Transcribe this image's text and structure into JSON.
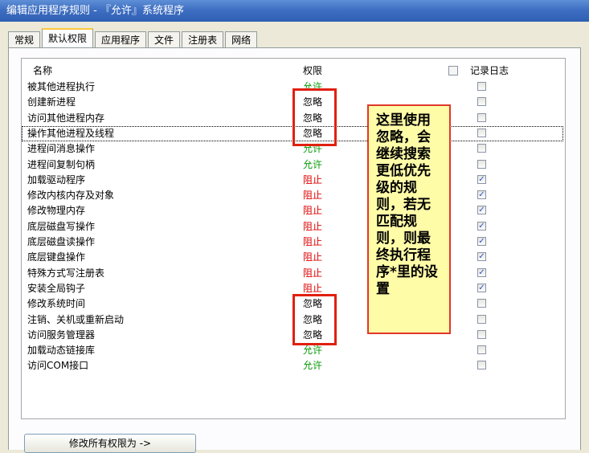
{
  "window": {
    "title": "编辑应用程序规则 - 『允许』系统程序"
  },
  "tabs": [
    "常规",
    "默认权限",
    "应用程序",
    "文件",
    "注册表",
    "网络"
  ],
  "active_tab": 1,
  "list": {
    "headers": {
      "name": "名称",
      "permission": "权限",
      "log": "记录日志"
    },
    "rows": [
      {
        "name": "被其他进程执行",
        "perm": "允许",
        "type": "allow",
        "log": false
      },
      {
        "name": "创建新进程",
        "perm": "忽略",
        "type": "ignore",
        "log": false
      },
      {
        "name": "访问其他进程内存",
        "perm": "忽略",
        "type": "ignore",
        "log": false
      },
      {
        "name": "操作其他进程及线程",
        "perm": "忽略",
        "type": "ignore",
        "log": false
      },
      {
        "name": "进程间消息操作",
        "perm": "允许",
        "type": "allow",
        "log": false
      },
      {
        "name": "进程间复制句柄",
        "perm": "允许",
        "type": "allow",
        "log": false
      },
      {
        "name": "加载驱动程序",
        "perm": "阻止",
        "type": "block",
        "log": true
      },
      {
        "name": "修改内核内存及对象",
        "perm": "阻止",
        "type": "block",
        "log": true
      },
      {
        "name": "修改物理内存",
        "perm": "阻止",
        "type": "block",
        "log": true
      },
      {
        "name": "底层磁盘写操作",
        "perm": "阻止",
        "type": "block",
        "log": true
      },
      {
        "name": "底层磁盘读操作",
        "perm": "阻止",
        "type": "block",
        "log": true
      },
      {
        "name": "底层键盘操作",
        "perm": "阻止",
        "type": "block",
        "log": true
      },
      {
        "name": "特殊方式写注册表",
        "perm": "阻止",
        "type": "block",
        "log": true
      },
      {
        "name": "安装全局钩子",
        "perm": "阻止",
        "type": "block",
        "log": true
      },
      {
        "name": "修改系统时间",
        "perm": "忽略",
        "type": "ignore",
        "log": false
      },
      {
        "name": "注销、关机或重新启动",
        "perm": "忽略",
        "type": "ignore",
        "log": false
      },
      {
        "name": "访问服务管理器",
        "perm": "忽略",
        "type": "ignore",
        "log": false
      },
      {
        "name": "加载动态链接库",
        "perm": "允许",
        "type": "allow",
        "log": false
      },
      {
        "name": "访问COM接口",
        "perm": "允许",
        "type": "allow",
        "log": false
      }
    ]
  },
  "annotation": {
    "text": "这里使用忽略，会继续搜索更低优先级的规则，若无匹配规则，则最终执行程序*里的设置"
  },
  "buttons": {
    "modify_all": "修改所有权限为 ->"
  },
  "colors": {
    "allow": "#0a9a0a",
    "block": "#e00000",
    "ignore": "#000000",
    "highlight": "#e02010",
    "note_bg": "#fffca8"
  }
}
